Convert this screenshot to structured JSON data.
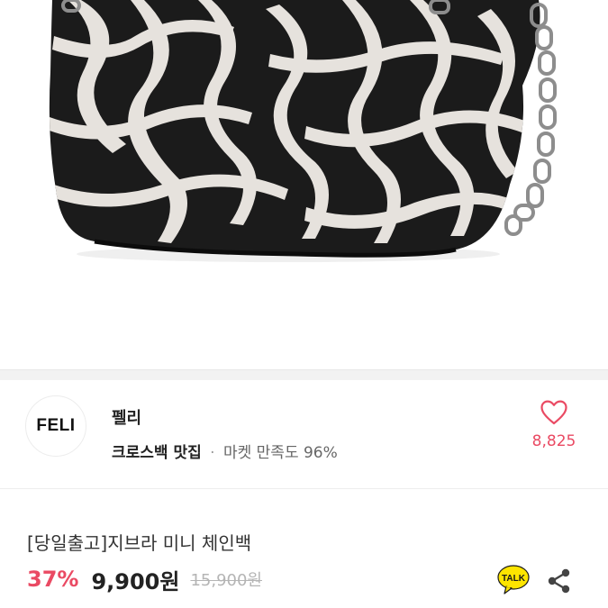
{
  "shop": {
    "logo_text": "FELI",
    "name": "펠리",
    "tag": "크로스백 맛집",
    "separator": "·",
    "satisfaction": "마켓 만족도 96%"
  },
  "like": {
    "count": "8,825"
  },
  "product": {
    "title": "[당일출고]지브라 미니 체인백",
    "discount": "37%",
    "price": "9,900원",
    "original_price": "15,900원"
  },
  "actions": {
    "talk_label": "TALK"
  },
  "colors": {
    "accent": "#ea4a63",
    "talk_yellow": "#fee500",
    "divider": "#f2f2f2"
  }
}
